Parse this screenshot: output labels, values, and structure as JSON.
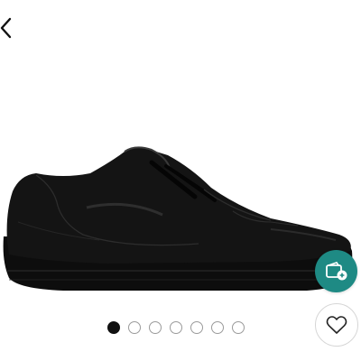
{
  "navigation": {
    "back_icon": "chevron-left-icon"
  },
  "product": {
    "image_icon": "black-leather-sneaker-image"
  },
  "actions": {
    "wallet_icon": "wallet-add-icon",
    "wishlist_icon": "heart-outline-icon",
    "accent_color": "#1e8a84"
  },
  "carousel": {
    "total": 7,
    "active_index": 0
  }
}
